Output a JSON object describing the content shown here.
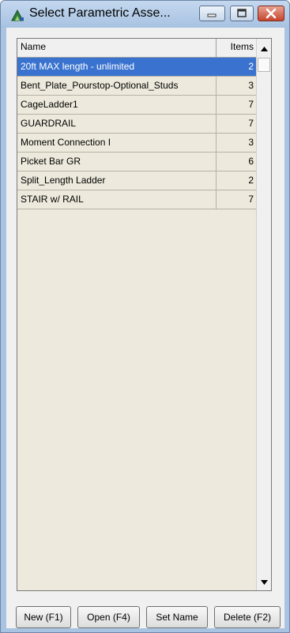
{
  "window": {
    "title": "Select Parametric Asse..."
  },
  "list": {
    "columns": {
      "name": "Name",
      "items": "Items"
    },
    "rows": [
      {
        "name": "20ft MAX length - unlimited",
        "items": "2",
        "selected": true
      },
      {
        "name": "Bent_Plate_Pourstop-Optional_Studs",
        "items": "3"
      },
      {
        "name": "CageLadder1",
        "items": "7"
      },
      {
        "name": "GUARDRAIL",
        "items": "7"
      },
      {
        "name": "Moment Connection I",
        "items": "3"
      },
      {
        "name": "Picket Bar GR",
        "items": "6"
      },
      {
        "name": "Split_Length Ladder",
        "items": "2"
      },
      {
        "name": "STAIR w/ RAIL",
        "items": "7"
      }
    ]
  },
  "buttons": {
    "new": "New (F1)",
    "open": "Open (F4)",
    "set_name": "Set Name",
    "delete": "Delete (F2)"
  },
  "colors": {
    "selection": "#3a73cf",
    "list_background": "#ede9dc",
    "title_bar": "#b3cbe6",
    "close_button": "#c7452e"
  },
  "icons": [
    "app-icon",
    "minimize-icon",
    "maximize-icon",
    "close-icon",
    "scroll-up-icon",
    "scroll-down-icon"
  ]
}
